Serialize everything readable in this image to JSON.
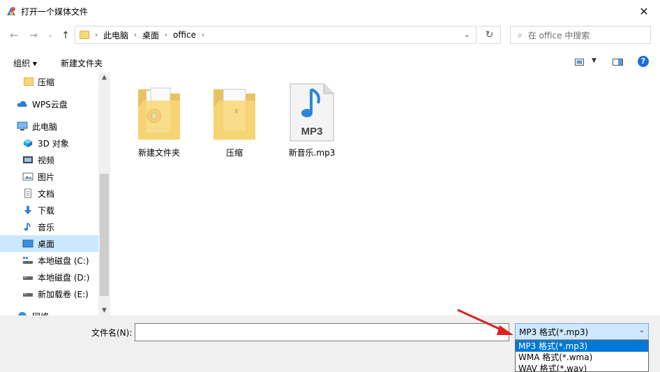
{
  "window": {
    "title": "打开一个媒体文件",
    "close_glyph": "✕"
  },
  "nav": {
    "back": "←",
    "forward": "→",
    "recent": "⌄",
    "up": "↑",
    "breadcrumb": [
      "此电脑",
      "桌面",
      "office"
    ],
    "refresh": "↻",
    "search_placeholder": "在 office 中搜索"
  },
  "toolbar": {
    "organize": "组织 ▾",
    "new_folder": "新建文件夹",
    "help": "?"
  },
  "sidebar": {
    "items": [
      {
        "label": "压缩",
        "icon": "folder-icon"
      },
      {
        "label": "WPS云盘",
        "icon": "cloud-icon"
      },
      {
        "label": "此电脑",
        "icon": "computer-icon"
      },
      {
        "label": "3D 对象",
        "icon": "cube-icon"
      },
      {
        "label": "视频",
        "icon": "video-icon"
      },
      {
        "label": "图片",
        "icon": "picture-icon"
      },
      {
        "label": "文档",
        "icon": "document-icon"
      },
      {
        "label": "下载",
        "icon": "download-icon"
      },
      {
        "label": "音乐",
        "icon": "music-icon"
      },
      {
        "label": "桌面",
        "icon": "desktop-icon"
      },
      {
        "label": "本地磁盘 (C:)",
        "icon": "drive-icon"
      },
      {
        "label": "本地磁盘 (D:)",
        "icon": "drive-icon"
      },
      {
        "label": "新加载卷 (E:)",
        "icon": "drive-icon"
      },
      {
        "label": "网络",
        "icon": "network-icon"
      }
    ]
  },
  "files": [
    {
      "name": "新建文件夹",
      "icon": "folder-icon"
    },
    {
      "name": "压缩",
      "icon": "folder-icon"
    },
    {
      "name": "新音乐.mp3",
      "icon": "mp3-file-icon",
      "badge": "MP3"
    }
  ],
  "bottom": {
    "filename_label": "文件名(N):",
    "filename_value": "",
    "filetype_selected": "MP3 格式(*.mp3)",
    "filetype_options": [
      "MP3 格式(*.mp3)",
      "WMA 格式(*.wma)",
      "WAV 格式(*.wav)"
    ]
  }
}
